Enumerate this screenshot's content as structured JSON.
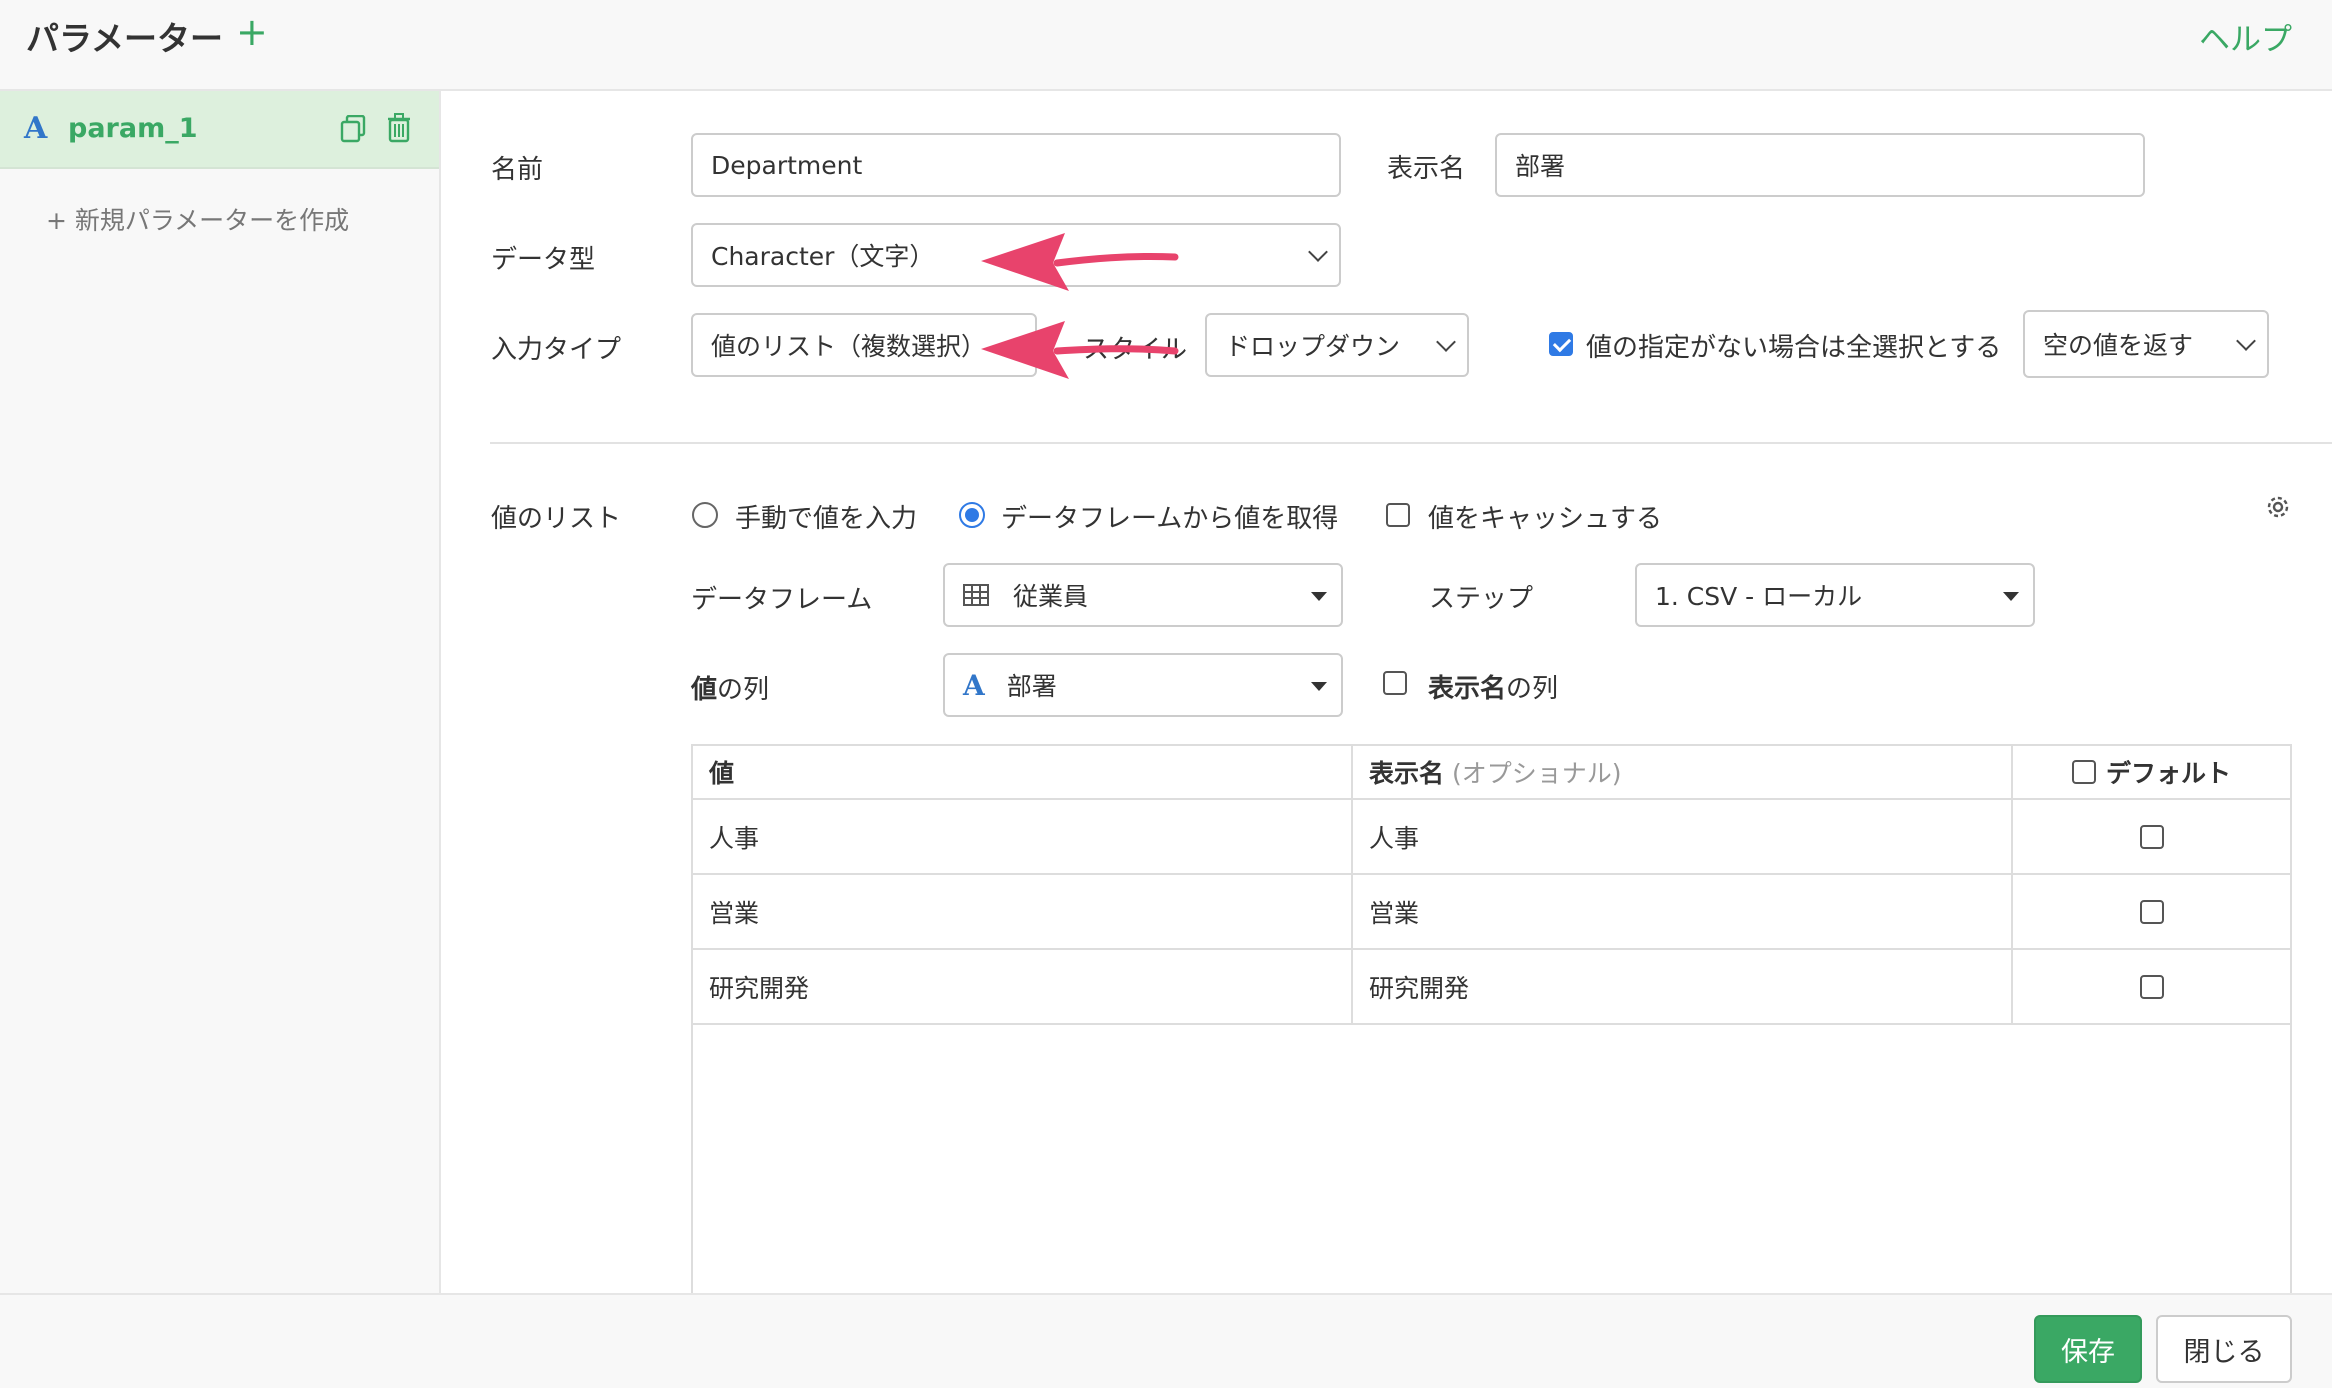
{
  "header": {
    "title": "パラメーター",
    "add_icon": "plus-icon",
    "help": "ヘルプ"
  },
  "sidebar": {
    "param": {
      "type_glyph": "A",
      "name": "param_1",
      "copy_icon": "copy-icon",
      "delete_icon": "trash-icon"
    },
    "new_param": "+ 新規パラメーターを作成"
  },
  "form": {
    "name_label": "名前",
    "name_value": "Department",
    "display_name_label": "表示名",
    "display_name_value": "部署",
    "data_type_label": "データ型",
    "data_type_value": "Character（文字）",
    "input_type_label": "入力タイプ",
    "input_type_value": "値のリスト（複数選択）",
    "style_label": "スタイル",
    "style_value": "ドロップダウン",
    "select_all_label": "値の指定がない場合は全選択とする",
    "select_all_checked": true,
    "empty_value_select": "空の値を返す"
  },
  "values": {
    "label": "値のリスト",
    "radio_manual": "手動で値を入力",
    "radio_dataframe": "データフレームから値を取得",
    "selected_source": "dataframe",
    "cache_label": "値をキャッシュする",
    "cache_checked": false,
    "dataframe_label": "データフレーム",
    "dataframe_value": "従業員",
    "step_label": "ステップ",
    "step_value": "1. CSV - ローカル",
    "value_column_label_bold": "値",
    "value_column_label_rest": "の列",
    "value_column_value": "部署",
    "display_column_bold": "表示名",
    "display_column_rest": "の列",
    "display_column_checked": false
  },
  "table": {
    "headers": {
      "value": "値",
      "display": "表示名",
      "display_optional": "(オプショナル)",
      "default": "デフォルト"
    },
    "rows": [
      {
        "value": "人事",
        "display": "人事",
        "default": false
      },
      {
        "value": "営業",
        "display": "営業",
        "default": false
      },
      {
        "value": "研究開発",
        "display": "研究開発",
        "default": false
      }
    ]
  },
  "footer": {
    "save": "保存",
    "close": "閉じる"
  },
  "colors": {
    "accent": "#3aa864",
    "blue": "#2f7ae5",
    "arrow": "#e8436c"
  }
}
